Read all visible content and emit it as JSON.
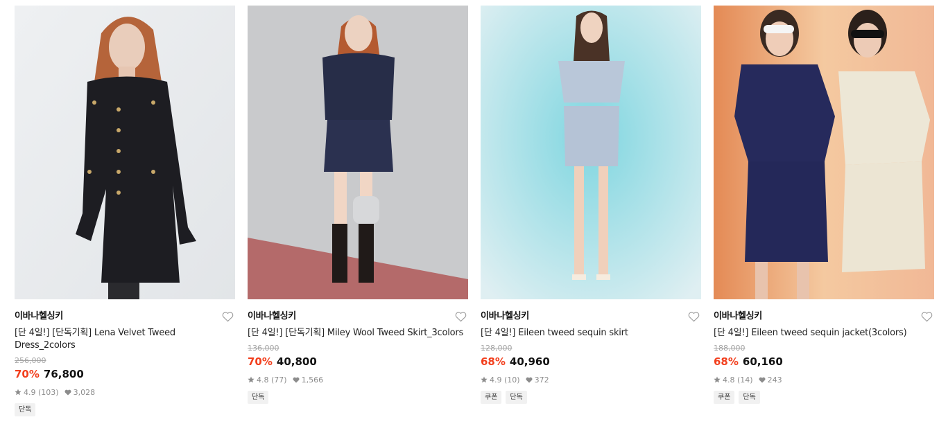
{
  "products": [
    {
      "brand": "이바나헬싱키",
      "title": "[단 4일!] [단독기획] Lena Velvet Tweed Dress_2colors",
      "original_price": "256,000",
      "discount": "70%",
      "price": "76,800",
      "rating": "4.9",
      "reviews": "(103)",
      "likes": "3,028",
      "tags": [
        "단독"
      ]
    },
    {
      "brand": "이바나헬싱키",
      "title": "[단 4일!] [단독기획] Miley Wool Tweed Skirt_3colors",
      "original_price": "136,000",
      "discount": "70%",
      "price": "40,800",
      "rating": "4.8",
      "reviews": "(77)",
      "likes": "1,566",
      "tags": [
        "단독"
      ]
    },
    {
      "brand": "이바나헬싱키",
      "title": "[단 4일!] Eileen tweed sequin skirt",
      "original_price": "128,000",
      "discount": "68%",
      "price": "40,960",
      "rating": "4.9",
      "reviews": "(10)",
      "likes": "372",
      "tags": [
        "쿠폰",
        "단독"
      ]
    },
    {
      "brand": "이바나헬싱키",
      "title": "[단 4일!] Eileen tweed sequin jacket(3colors)",
      "original_price": "188,000",
      "discount": "68%",
      "price": "60,160",
      "rating": "4.8",
      "reviews": "(14)",
      "likes": "243",
      "tags": [
        "쿠폰",
        "단독"
      ]
    }
  ],
  "icons": {
    "like": "heart-outline-icon",
    "rating": "star-icon",
    "likes": "heart-filled-icon"
  },
  "colors": {
    "discount": "#f23e1c",
    "muted": "#8c8c8c",
    "tag_bg": "#f1f1f1"
  }
}
